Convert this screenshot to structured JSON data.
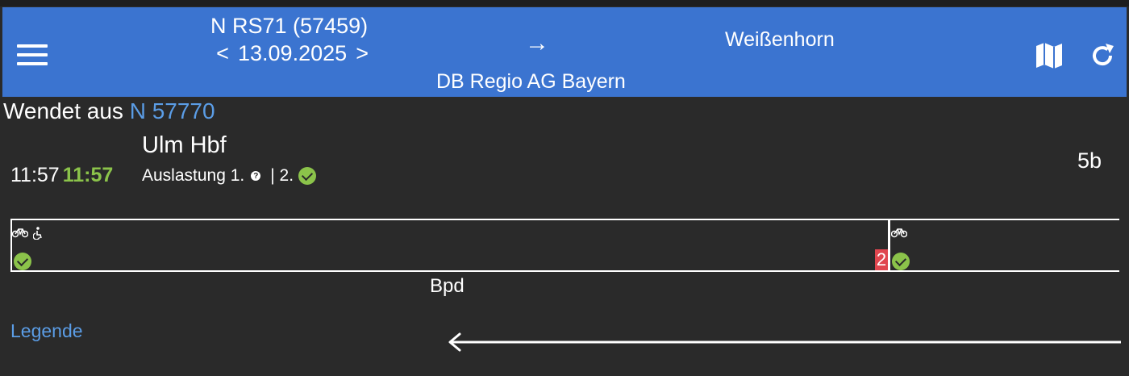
{
  "header": {
    "train_name": "N RS71 (57459)",
    "date": "13.09.2025",
    "prev_label": "<",
    "next_label": ">",
    "arrow": "→",
    "destination": "Weißenhorn",
    "operator": "DB Regio AG Bayern"
  },
  "turns": {
    "label": "Wendet aus",
    "train": "N 57770"
  },
  "stop": {
    "station": "Ulm Hbf",
    "scheduled": "11:57",
    "actual": "11:57",
    "load_first_label": "Auslastung 1.",
    "load_second_label": "| 2.",
    "platform": "5b"
  },
  "formation": {
    "coach2_class": "2",
    "coach_type": "Bpd"
  },
  "legend": "Legende",
  "colors": {
    "header_bg": "#3b74d0",
    "bg": "#2a2a2a",
    "ok": "#8bc34a",
    "link": "#5b9de6",
    "class2": "#e0464f"
  }
}
